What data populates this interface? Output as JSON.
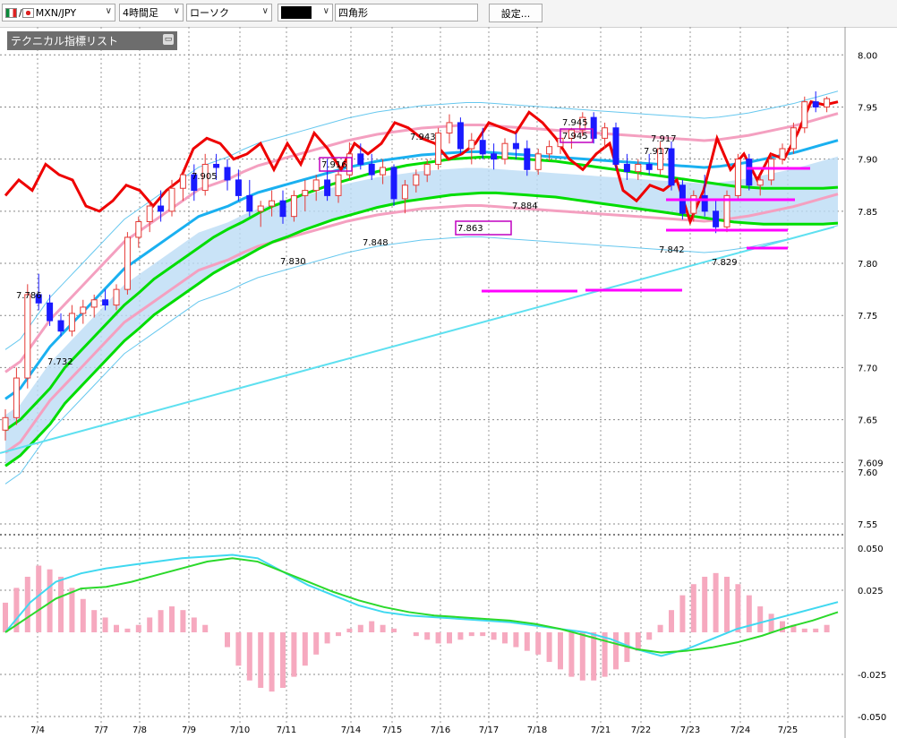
{
  "toolbar": {
    "pair": "MXN/JPY",
    "pair_prefix": "/",
    "timeframe": "4時間足",
    "chart_style": "ローソク",
    "color_selected": "",
    "draw_shape": "四角形",
    "settings_label": "設定..."
  },
  "indicator_panel": {
    "title": "テクニカル指標リスト"
  },
  "colors": {
    "up_candle": "#e53935",
    "down_candle": "#1a1aff",
    "rsi_red": "#ee0000",
    "ma_green": "#00dd00",
    "ma_blue": "#1ab0f0",
    "bollinger_pink": "#f4a0c0",
    "bollinger_outer": "#67c8ef",
    "cloud": "#bcdcf5",
    "marker": "#ff00ff"
  },
  "chart_data": {
    "type": "candlestick",
    "xlabels": [
      "7/4",
      "7/7",
      "7/8",
      "7/9",
      "7/10",
      "7/11",
      "7/14",
      "7/15",
      "7/16",
      "7/17",
      "7/18",
      "7/21",
      "7/22",
      "7/23",
      "7/24",
      "7/25"
    ],
    "main_axis": {
      "ylim": [
        7.55,
        8.02
      ],
      "ticks": [
        "8.00",
        "7.95",
        "7.90",
        "7.85",
        "7.80",
        "7.75",
        "7.70",
        "7.65",
        "7.609",
        "7.60",
        "7.55"
      ]
    },
    "sub_axis": {
      "ylim": [
        -0.05,
        0.05
      ],
      "ticks": [
        "0.050",
        "0.025",
        "-0.025",
        "-0.050"
      ]
    },
    "price_labels": [
      {
        "text": "7.786",
        "x": 0.6,
        "y": 7.786
      },
      {
        "text": "7.732",
        "x": 3.0,
        "y": 7.732
      },
      {
        "text": "7.905",
        "x": 8.3,
        "y": 7.905
      },
      {
        "text": "7.830",
        "x": 12.4,
        "y": 7.83
      },
      {
        "text": "7.916",
        "x": 14.6,
        "y": 7.916
      },
      {
        "text": "7.848",
        "x": 16.9,
        "y": 7.848
      },
      {
        "text": "7.943",
        "x": 19.2,
        "y": 7.943
      },
      {
        "text": "7.863",
        "x": 21.7,
        "y": 7.863
      },
      {
        "text": "7.884",
        "x": 24.3,
        "y": 7.884
      },
      {
        "text": "7.945",
        "x": 26.4,
        "y": 7.945
      },
      {
        "text": "7.945",
        "x": 26.4,
        "y": 7.945
      },
      {
        "text": "7.917",
        "x": 31.0,
        "y": 7.917
      },
      {
        "text": "7.917",
        "x": 30.4,
        "y": 7.917
      },
      {
        "text": "7.842",
        "x": 31.3,
        "y": 7.842
      },
      {
        "text": "7.829",
        "x": 34.2,
        "y": 7.829
      }
    ],
    "boxed_labels": [
      "7.916",
      "7.863",
      "7.945"
    ],
    "candles": [
      [
        7.64,
        7.66,
        7.63,
        7.652
      ],
      [
        7.652,
        7.7,
        7.645,
        7.69
      ],
      [
        7.69,
        7.78,
        7.68,
        7.77
      ],
      [
        7.77,
        7.79,
        7.755,
        7.762
      ],
      [
        7.762,
        7.77,
        7.74,
        7.745
      ],
      [
        7.745,
        7.752,
        7.73,
        7.735
      ],
      [
        7.735,
        7.76,
        7.73,
        7.752
      ],
      [
        7.752,
        7.765,
        7.742,
        7.758
      ],
      [
        7.758,
        7.77,
        7.748,
        7.765
      ],
      [
        7.765,
        7.775,
        7.755,
        7.76
      ],
      [
        7.76,
        7.78,
        7.755,
        7.775
      ],
      [
        7.775,
        7.83,
        7.77,
        7.825
      ],
      [
        7.825,
        7.845,
        7.815,
        7.84
      ],
      [
        7.84,
        7.86,
        7.83,
        7.855
      ],
      [
        7.855,
        7.87,
        7.84,
        7.85
      ],
      [
        7.85,
        7.88,
        7.845,
        7.872
      ],
      [
        7.872,
        7.89,
        7.86,
        7.885
      ],
      [
        7.885,
        7.895,
        7.86,
        7.87
      ],
      [
        7.87,
        7.905,
        7.865,
        7.895
      ],
      [
        7.895,
        7.905,
        7.88,
        7.892
      ],
      [
        7.892,
        7.9,
        7.87,
        7.88
      ],
      [
        7.88,
        7.89,
        7.86,
        7.865
      ],
      [
        7.865,
        7.88,
        7.845,
        7.85
      ],
      [
        7.85,
        7.86,
        7.835,
        7.855
      ],
      [
        7.855,
        7.87,
        7.845,
        7.86
      ],
      [
        7.86,
        7.87,
        7.838,
        7.845
      ],
      [
        7.845,
        7.87,
        7.84,
        7.865
      ],
      [
        7.865,
        7.88,
        7.85,
        7.87
      ],
      [
        7.87,
        7.885,
        7.86,
        7.88
      ],
      [
        7.88,
        7.9,
        7.86,
        7.865
      ],
      [
        7.865,
        7.89,
        7.858,
        7.885
      ],
      [
        7.885,
        7.916,
        7.88,
        7.905
      ],
      [
        7.905,
        7.915,
        7.89,
        7.895
      ],
      [
        7.895,
        7.905,
        7.88,
        7.885
      ],
      [
        7.885,
        7.9,
        7.876,
        7.892
      ],
      [
        7.892,
        7.895,
        7.855,
        7.862
      ],
      [
        7.862,
        7.88,
        7.848,
        7.875
      ],
      [
        7.875,
        7.89,
        7.868,
        7.885
      ],
      [
        7.885,
        7.9,
        7.878,
        7.895
      ],
      [
        7.895,
        7.93,
        7.89,
        7.925
      ],
      [
        7.925,
        7.943,
        7.915,
        7.935
      ],
      [
        7.935,
        7.94,
        7.905,
        7.91
      ],
      [
        7.91,
        7.925,
        7.895,
        7.918
      ],
      [
        7.918,
        7.93,
        7.9,
        7.905
      ],
      [
        7.905,
        7.915,
        7.89,
        7.9
      ],
      [
        7.9,
        7.92,
        7.895,
        7.915
      ],
      [
        7.915,
        7.925,
        7.9,
        7.91
      ],
      [
        7.91,
        7.918,
        7.884,
        7.89
      ],
      [
        7.89,
        7.91,
        7.885,
        7.905
      ],
      [
        7.905,
        7.918,
        7.898,
        7.912
      ],
      [
        7.912,
        7.925,
        7.905,
        7.92
      ],
      [
        7.92,
        7.93,
        7.91,
        7.928
      ],
      [
        7.928,
        7.945,
        7.922,
        7.94
      ],
      [
        7.94,
        7.945,
        7.915,
        7.92
      ],
      [
        7.92,
        7.935,
        7.91,
        7.93
      ],
      [
        7.93,
        7.935,
        7.89,
        7.895
      ],
      [
        7.895,
        7.905,
        7.88,
        7.888
      ],
      [
        7.888,
        7.9,
        7.88,
        7.895
      ],
      [
        7.895,
        7.905,
        7.885,
        7.89
      ],
      [
        7.89,
        7.917,
        7.885,
        7.91
      ],
      [
        7.91,
        7.917,
        7.87,
        7.875
      ],
      [
        7.875,
        7.88,
        7.842,
        7.848
      ],
      [
        7.848,
        7.87,
        7.84,
        7.865
      ],
      [
        7.865,
        7.885,
        7.845,
        7.85
      ],
      [
        7.85,
        7.86,
        7.829,
        7.835
      ],
      [
        7.835,
        7.87,
        7.83,
        7.865
      ],
      [
        7.865,
        7.905,
        7.86,
        7.9
      ],
      [
        7.9,
        7.905,
        7.87,
        7.875
      ],
      [
        7.875,
        7.885,
        7.865,
        7.88
      ],
      [
        7.88,
        7.905,
        7.875,
        7.9
      ],
      [
        7.9,
        7.915,
        7.895,
        7.91
      ],
      [
        7.91,
        7.935,
        7.905,
        7.93
      ],
      [
        7.93,
        7.96,
        7.925,
        7.955
      ],
      [
        7.955,
        7.965,
        7.945,
        7.95
      ],
      [
        7.95,
        7.96,
        7.945,
        7.958
      ]
    ],
    "series": [
      {
        "values": [
          7.865,
          7.88,
          7.87,
          7.895,
          7.885,
          7.88,
          7.855,
          7.85,
          7.86,
          7.875,
          7.87,
          7.855,
          7.87,
          7.88,
          7.91,
          7.92,
          7.915,
          7.9,
          7.905,
          7.915,
          7.89,
          7.915,
          7.895,
          7.925,
          7.91,
          7.89,
          7.915,
          7.905,
          7.915,
          7.935,
          7.93,
          7.92,
          7.915,
          7.9,
          7.905,
          7.915,
          7.935,
          7.93,
          7.925,
          7.945,
          7.935,
          7.92,
          7.9,
          7.89,
          7.905,
          7.915,
          7.87,
          7.86,
          7.875,
          7.87,
          7.88,
          7.84,
          7.87,
          7.92,
          7.89,
          7.905,
          7.88,
          7.905,
          7.9,
          7.925,
          7.955,
          7.952,
          7.955
        ]
      },
      {
        "values": [
          7.67,
          7.68,
          7.7,
          7.72,
          7.735,
          7.75,
          7.765,
          7.78,
          7.795,
          7.805,
          7.815,
          7.825,
          7.835,
          7.845,
          7.85,
          7.855,
          7.862,
          7.868,
          7.872,
          7.876,
          7.88,
          7.884,
          7.888,
          7.892,
          7.895,
          7.898,
          7.9,
          7.902,
          7.904,
          7.905,
          7.906,
          7.907,
          7.907,
          7.906,
          7.905,
          7.904,
          7.903,
          7.902,
          7.901,
          7.9,
          7.899,
          7.898,
          7.897,
          7.896,
          7.895,
          7.894,
          7.893,
          7.892,
          7.893,
          7.895,
          7.897,
          7.9,
          7.903,
          7.906,
          7.91,
          7.914,
          7.918
        ]
      },
      {
        "values": [
          7.64,
          7.65,
          7.665,
          7.68,
          7.7,
          7.715,
          7.73,
          7.745,
          7.76,
          7.772,
          7.785,
          7.795,
          7.805,
          7.815,
          7.825,
          7.833,
          7.84,
          7.848,
          7.855,
          7.86,
          7.866,
          7.871,
          7.876,
          7.88,
          7.884,
          7.888,
          7.891,
          7.894,
          7.896,
          7.898,
          7.9,
          7.901,
          7.902,
          7.902,
          7.901,
          7.9,
          7.899,
          7.898,
          7.896,
          7.894,
          7.892,
          7.89,
          7.888,
          7.886,
          7.884,
          7.882,
          7.88,
          7.878,
          7.876,
          7.874,
          7.873,
          7.872,
          7.872,
          7.872,
          7.872,
          7.872,
          7.873
        ]
      }
    ],
    "histogram": [
      0.008,
      0.012,
      0.015,
      0.018,
      0.017,
      0.015,
      0.012,
      0.009,
      0.006,
      0.004,
      0.002,
      0.001,
      0.002,
      0.004,
      0.006,
      0.007,
      0.006,
      0.004,
      0.002,
      0.0,
      -0.004,
      -0.009,
      -0.013,
      -0.015,
      -0.016,
      -0.015,
      -0.012,
      -0.009,
      -0.006,
      -0.003,
      -0.001,
      0.001,
      0.002,
      0.003,
      0.002,
      0.001,
      0.0,
      -0.001,
      -0.002,
      -0.003,
      -0.003,
      -0.002,
      -0.001,
      -0.001,
      -0.002,
      -0.003,
      -0.004,
      -0.005,
      -0.006,
      -0.008,
      -0.01,
      -0.012,
      -0.013,
      -0.013,
      -0.012,
      -0.01,
      -0.008,
      -0.005,
      -0.002,
      0.002,
      0.006,
      0.01,
      0.013,
      0.015,
      0.016,
      0.015,
      0.013,
      0.01,
      0.007,
      0.005,
      0.003,
      0.002,
      0.001,
      0.001,
      0.002
    ]
  }
}
